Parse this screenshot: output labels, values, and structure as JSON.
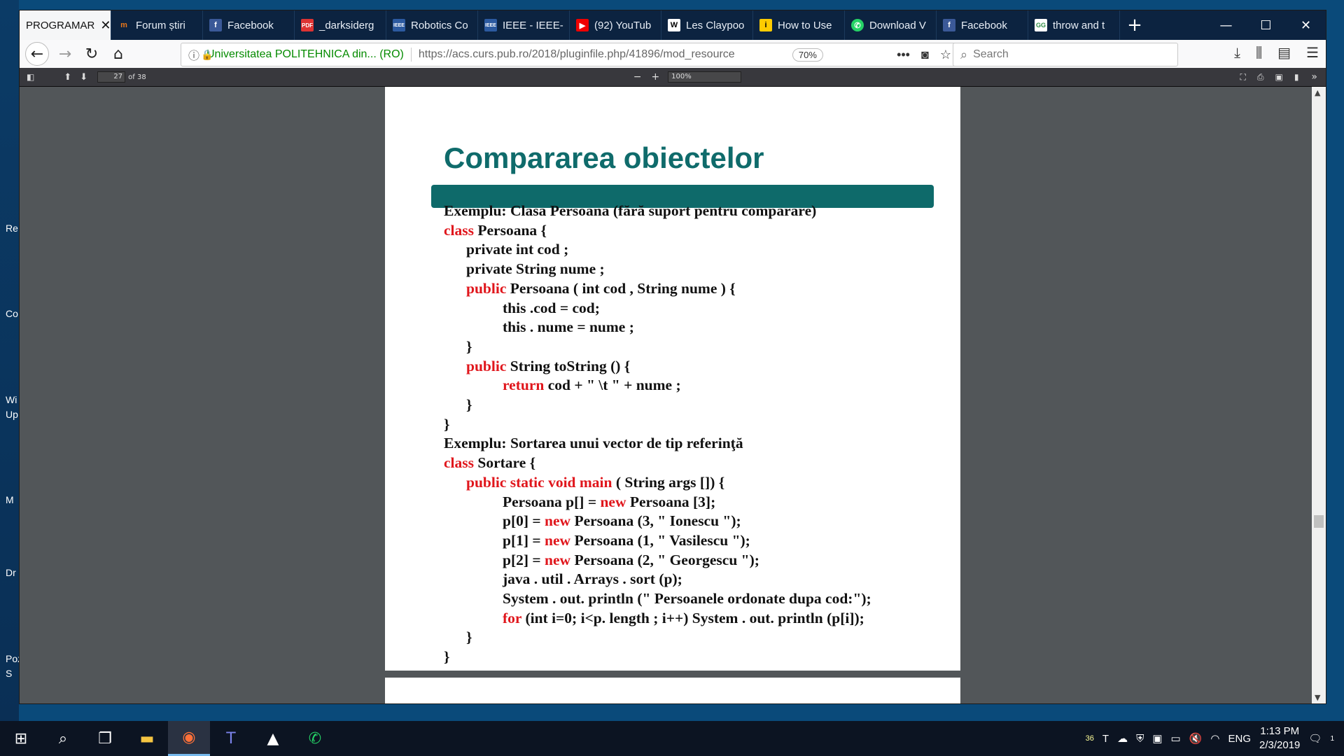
{
  "desktop": {
    "labels": [
      "Re",
      "Co",
      "Wi",
      "Up",
      "M",
      "Dr",
      "Poz",
      "S"
    ]
  },
  "tabs": [
    {
      "label": "PROGRAMAR",
      "icon": "",
      "active": true
    },
    {
      "label": "Forum știri",
      "icon": "forum-icon"
    },
    {
      "label": "Facebook",
      "icon": "facebook-icon"
    },
    {
      "label": "_darksiderg",
      "icon": "pdf-icon"
    },
    {
      "label": "Robotics Co",
      "icon": "ieee-icon"
    },
    {
      "label": "IEEE - IEEE-",
      "icon": "ieee-icon"
    },
    {
      "label": "(92) YouTub",
      "icon": "youtube-icon"
    },
    {
      "label": "Les Claypoo",
      "icon": "wikipedia-icon"
    },
    {
      "label": "How to Use",
      "icon": "instructables-icon"
    },
    {
      "label": "Download V",
      "icon": "whatsapp-icon"
    },
    {
      "label": "Facebook",
      "icon": "facebook-icon"
    },
    {
      "label": "throw and t",
      "icon": "geeks-icon"
    }
  ],
  "nav": {
    "secure_label": "Universitatea POLITEHNICA din... (RO)",
    "url": "https://acs.curs.pub.ro/2018/pluginfile.php/41896/mod_resource",
    "zoom": "70%",
    "search_placeholder": "Search"
  },
  "pdf": {
    "page_number": "27",
    "page_total": "of 38",
    "zoom": "100%"
  },
  "slide": {
    "title": "Compararea obiectelor",
    "lines": [
      {
        "indent": 0,
        "parts": [
          {
            "t": "Exemplu: Clasa Persoana (fără suport pentru comparare)"
          }
        ]
      },
      {
        "indent": 0,
        "parts": [
          {
            "t": "class",
            "kw": true
          },
          {
            "t": " Persoana {"
          }
        ]
      },
      {
        "indent": 1,
        "parts": [
          {
            "t": "private int cod ;"
          }
        ]
      },
      {
        "indent": 1,
        "parts": [
          {
            "t": "private String nume ;"
          }
        ]
      },
      {
        "indent": 1,
        "parts": [
          {
            "t": "public",
            "kw": true
          },
          {
            "t": " Persoana ( int cod , String nume ) {"
          }
        ]
      },
      {
        "indent": 2,
        "parts": [
          {
            "t": "this .cod = cod;"
          }
        ]
      },
      {
        "indent": 2,
        "parts": [
          {
            "t": "this . nume = nume ;"
          }
        ]
      },
      {
        "indent": 1,
        "parts": [
          {
            "t": "}"
          }
        ]
      },
      {
        "indent": 1,
        "parts": [
          {
            "t": "public",
            "kw": true
          },
          {
            "t": " String toString () {"
          }
        ]
      },
      {
        "indent": 2,
        "parts": [
          {
            "t": "return",
            "kw": true
          },
          {
            "t": " cod + \" \\t \" + nume ;"
          }
        ]
      },
      {
        "indent": 1,
        "parts": [
          {
            "t": "}"
          }
        ]
      },
      {
        "indent": 0,
        "parts": [
          {
            "t": "}"
          }
        ]
      },
      {
        "indent": 0,
        "parts": [
          {
            "t": "Exemplu: Sortarea unui vector de tip referinţă"
          }
        ]
      },
      {
        "indent": 0,
        "parts": [
          {
            "t": "class",
            "kw": true
          },
          {
            "t": " Sortare {"
          }
        ]
      },
      {
        "indent": 1,
        "parts": [
          {
            "t": "public static void main",
            "kw": true
          },
          {
            "t": " ( String args []) {"
          }
        ]
      },
      {
        "indent": 2,
        "parts": [
          {
            "t": "Persoana p[] = "
          },
          {
            "t": "new",
            "kw": true
          },
          {
            "t": " Persoana [3];"
          }
        ]
      },
      {
        "indent": 2,
        "parts": [
          {
            "t": "p[0] = "
          },
          {
            "t": "new",
            "kw": true
          },
          {
            "t": " Persoana (3, \" Ionescu \");"
          }
        ]
      },
      {
        "indent": 2,
        "parts": [
          {
            "t": "p[1] = "
          },
          {
            "t": "new",
            "kw": true
          },
          {
            "t": " Persoana (1, \" Vasilescu \");"
          }
        ]
      },
      {
        "indent": 2,
        "parts": [
          {
            "t": "p[2] = "
          },
          {
            "t": "new",
            "kw": true
          },
          {
            "t": " Persoana (2, \" Georgescu \");"
          }
        ]
      },
      {
        "indent": 2,
        "parts": [
          {
            "t": "java . util . Arrays . sort (p);"
          }
        ]
      },
      {
        "indent": 2,
        "parts": [
          {
            "t": "System . out. println (\" Persoanele ordonate dupa cod:\");"
          }
        ]
      },
      {
        "indent": 2,
        "parts": [
          {
            "t": "for",
            "kw": true
          },
          {
            "t": " (int i=0; i<p. length ; i++) System . out. println (p[i]);"
          }
        ]
      },
      {
        "indent": 1,
        "parts": [
          {
            "t": "}"
          }
        ]
      },
      {
        "indent": 0,
        "parts": [
          {
            "t": "}"
          }
        ]
      }
    ]
  },
  "tray": {
    "badge": "36",
    "lang": "ENG",
    "time": "1:13 PM",
    "date": "2/3/2019",
    "notif": "1"
  },
  "colors": {
    "title": "#0f6b6b",
    "keyword": "#e0161c",
    "accent_bar": "#0e6a6a",
    "tabbar": "#0c2340"
  }
}
